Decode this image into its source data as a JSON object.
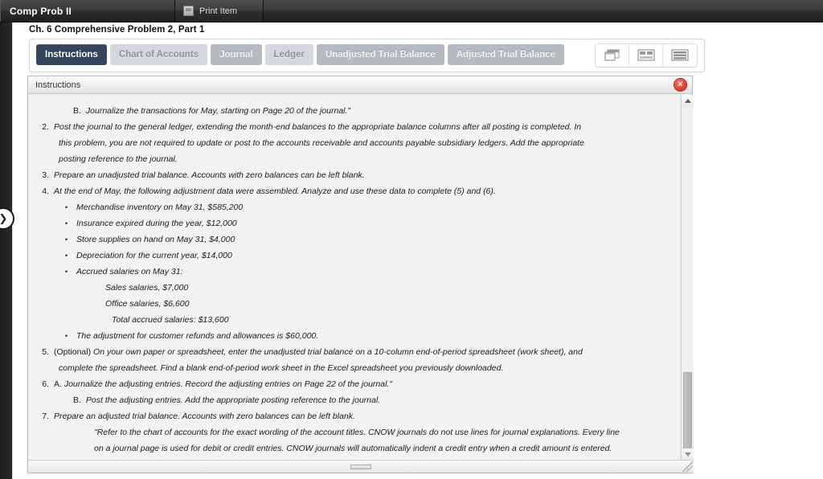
{
  "topbar": {
    "app_title": "Comp Prob II",
    "print_label": "Print Item",
    "print_icon": "printer-icon"
  },
  "page_title": "Ch. 6 Comprehensive Problem 2, Part 1",
  "tabs": [
    {
      "label": "Instructions",
      "active": true
    },
    {
      "label": "Chart of Accounts",
      "active": false
    },
    {
      "label": "Journal",
      "active": false
    },
    {
      "label": "Ledger",
      "active": false
    },
    {
      "label": "Unadjusted Trial Balance",
      "active": false
    },
    {
      "label": "Adjusted Trial Balance",
      "active": false
    }
  ],
  "view_buttons": [
    {
      "icon": "cascade-windows-icon"
    },
    {
      "icon": "split-panel-icon"
    },
    {
      "icon": "list-rows-icon"
    }
  ],
  "panel": {
    "title": "Instructions",
    "close_icon": "close-icon",
    "close_glyph": "×"
  },
  "rail": {
    "handle_icon": "chevron-right-icon",
    "handle_glyph": "❯"
  },
  "scrollbar": {
    "up_icon": "scroll-up-arrow-icon",
    "down_icon": "scroll-down-arrow-icon"
  },
  "instructions": {
    "item_b_label": "B.",
    "item_b_text": "Journalize the transactions for May, starting on Page 20 of the journal.\"",
    "item2_num": "2.",
    "item2_line1": "Post the journal to the general ledger, extending the month-end balances to the appropriate balance columns after all posting is completed. In",
    "item2_line2": "this problem, you are not required to update or post to the accounts receivable and accounts payable subsidiary ledgers. Add the appropriate",
    "item2_line3": "posting reference to the journal.",
    "item3_num": "3.",
    "item3_text": "Prepare an unadjusted trial balance. Accounts with zero balances can be left blank.",
    "item4_num": "4.",
    "item4_text": "At the end of May, the following adjustment data were assembled. Analyze and use these data to complete (5) and (6).",
    "bullet1": "Merchandise inventory on May 31, $585,200",
    "bullet2": "Insurance expired during the year, $12,000",
    "bullet3": "Store supplies on hand on May 31, $4,000",
    "bullet4": "Depreciation for the current year, $14,000",
    "bullet5": "Accrued salaries on May 31:",
    "salary_sales": "Sales salaries, $7,000",
    "salary_office": "Office salaries, $6,600",
    "salary_total": "Total accrued salaries: $13,600",
    "bullet6": "The adjustment for customer refunds and allowances is $60,000.",
    "item5_num": "5.",
    "item5_optional": "(Optional)",
    "item5_line1": "On your own paper or spreadsheet, enter the unadjusted trial balance on a 10-column end-of-period spreadsheet (work sheet), and",
    "item5_line2": "complete the spreadsheet. Find a blank end-of-period work sheet in the Excel spreadsheet you previously downloaded.",
    "item6_num": "6.",
    "item6a_label": "A.",
    "item6a_text": "Journalize the adjusting entries. Record the adjusting entries on Page 22 of the journal.\"",
    "item6b_label": "B.",
    "item6b_text": "Post the adjusting entries. Add the appropriate posting reference to the journal.",
    "item7_num": "7.",
    "item7_text": "Prepare an adjusted trial balance. Accounts with zero balances can be left blank.",
    "footnote_line1": "\"Refer to the chart of accounts for the exact wording of the account titles. CNOW journals do not use lines for journal explanations. Every line",
    "footnote_line2": "on a journal page is used for debit or credit entries. CNOW journals will automatically indent a credit entry when a credit amount is entered."
  },
  "colors": {
    "active_tab": "#35455e",
    "inactive_tab": "#d4d7dc",
    "close_red": "#e8473a",
    "topbar": "#2b2b2b"
  }
}
